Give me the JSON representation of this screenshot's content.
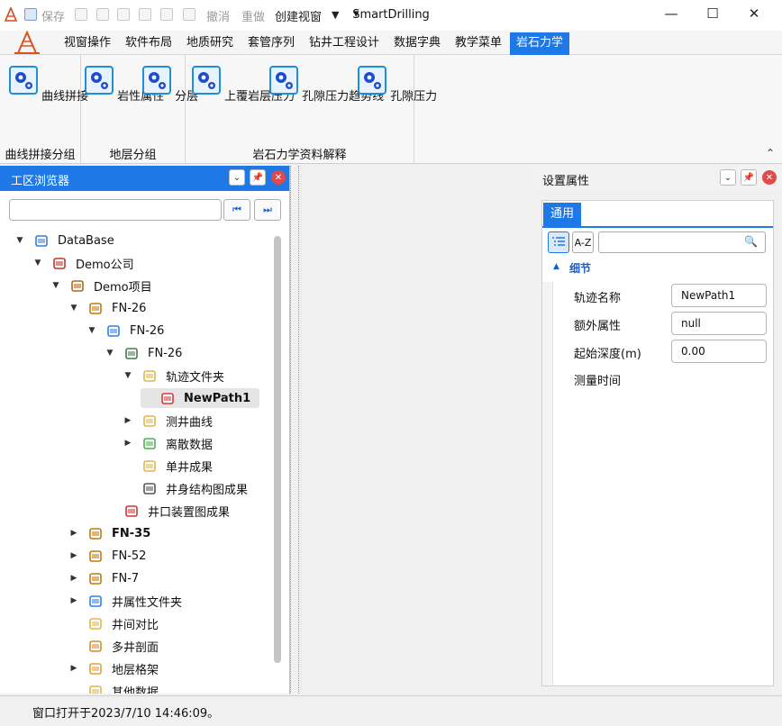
{
  "window": {
    "app_title": "SmartDrilling",
    "quick_access": {
      "save": "保存",
      "undo": "撤消",
      "redo": "重做",
      "create_window": "创建视窗",
      "dropdown": "▼",
      "more": "▾"
    },
    "controls": {
      "minimize": "—",
      "maximize": "☐",
      "close": "✕"
    }
  },
  "menu": {
    "tabs": [
      "视窗操作",
      "软件布局",
      "地质研究",
      "套管序列",
      "钻井工程设计",
      "数据字典",
      "教学菜单",
      "岩石力学"
    ],
    "active_index": 7
  },
  "ribbon": {
    "groups": [
      {
        "label": "曲线拼接分组",
        "buttons": [
          "曲线拼接"
        ]
      },
      {
        "label": "地层分组",
        "buttons": [
          "岩性属性",
          "分层"
        ]
      },
      {
        "label": "岩石力学资料解释",
        "buttons": [
          "上覆岩层压力",
          "孔隙压力趋势线",
          "孔隙压力"
        ]
      }
    ],
    "collapse_glyph": "⌃"
  },
  "browser": {
    "title": "工区浏览器",
    "header_buttons": {
      "dropdown": "⌄",
      "pin": "📌",
      "close": "✕"
    },
    "nav": {
      "first": "⏮",
      "last": "⏭"
    },
    "tree": [
      {
        "label": "DataBase",
        "depth": 0,
        "expander": "▼",
        "icon": "database-icon",
        "bold": false
      },
      {
        "label": "Demo公司",
        "depth": 1,
        "expander": "▼",
        "icon": "company-icon",
        "bold": false
      },
      {
        "label": "Demo项目",
        "depth": 2,
        "expander": "▼",
        "icon": "project-icon",
        "bold": false
      },
      {
        "label": "FN-26",
        "depth": 3,
        "expander": "▼",
        "icon": "well-icon",
        "bold": false
      },
      {
        "label": "FN-26",
        "depth": 4,
        "expander": "▼",
        "icon": "wellbore-icon",
        "bold": false
      },
      {
        "label": "FN-26",
        "depth": 5,
        "expander": "▼",
        "icon": "rig-icon",
        "bold": false
      },
      {
        "label": "轨迹文件夹",
        "depth": 6,
        "expander": "▼",
        "icon": "trajectory-folder-icon",
        "bold": false
      },
      {
        "label": "NewPath1",
        "depth": 7,
        "expander": "",
        "icon": "path-icon",
        "bold": true,
        "selected": true
      },
      {
        "label": "测井曲线",
        "depth": 6,
        "expander": "▶",
        "icon": "log-folder-icon",
        "bold": false
      },
      {
        "label": "离散数据",
        "depth": 6,
        "expander": "▶",
        "icon": "discrete-folder-icon",
        "bold": false
      },
      {
        "label": "单井成果",
        "depth": 6,
        "expander": "",
        "icon": "result-folder-icon",
        "bold": false
      },
      {
        "label": "井身结构图成果",
        "depth": 6,
        "expander": "",
        "icon": "structure-icon",
        "bold": false
      },
      {
        "label": "井口装置图成果",
        "depth": 5,
        "expander": "",
        "icon": "wellhead-icon",
        "bold": false
      },
      {
        "label": "FN-35",
        "depth": 3,
        "expander": "▶",
        "icon": "well-icon",
        "bold": true
      },
      {
        "label": "FN-52",
        "depth": 3,
        "expander": "▶",
        "icon": "well-icon",
        "bold": false
      },
      {
        "label": "FN-7",
        "depth": 3,
        "expander": "▶",
        "icon": "well-icon",
        "bold": false
      },
      {
        "label": "井属性文件夹",
        "depth": 3,
        "expander": "▶",
        "icon": "attr-folder-icon",
        "bold": false
      },
      {
        "label": "井间对比",
        "depth": 3,
        "expander": "",
        "icon": "compare-icon",
        "bold": false
      },
      {
        "label": "多井剖面",
        "depth": 3,
        "expander": "",
        "icon": "section-icon",
        "bold": false
      },
      {
        "label": "地层格架",
        "depth": 3,
        "expander": "▶",
        "icon": "strata-folder-icon",
        "bold": false
      },
      {
        "label": "其他数据",
        "depth": 3,
        "expander": "",
        "icon": "other-folder-icon",
        "bold": false
      }
    ]
  },
  "properties": {
    "title": "设置属性",
    "header_buttons": {
      "dropdown": "⌄",
      "pin": "📌",
      "close": "✕"
    },
    "tab": "通用",
    "sort_az": "A-Z",
    "search_glyph": "🔍",
    "section": "细节",
    "section_glyph": "▲",
    "rows": [
      {
        "name": "轨迹名称",
        "value": "NewPath1"
      },
      {
        "name": "额外属性",
        "value": "null"
      },
      {
        "name": "起始深度(m)",
        "value": "0.00"
      },
      {
        "name": "测量时间",
        "value": ""
      }
    ]
  },
  "status": {
    "text": "窗口打开于2023/7/10 14:46:09。"
  }
}
